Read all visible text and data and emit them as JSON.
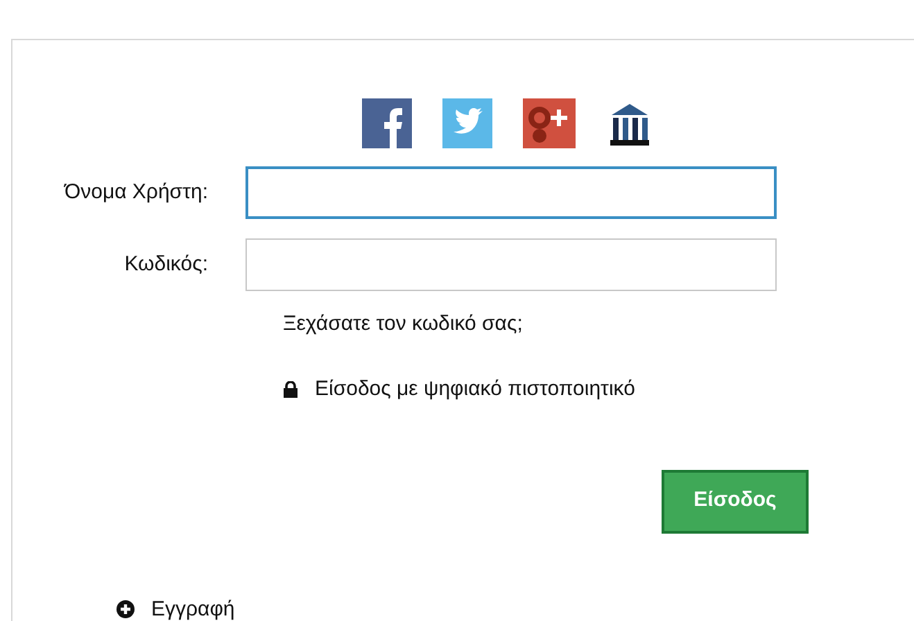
{
  "social_logins": [
    {
      "kind": "facebook"
    },
    {
      "kind": "twitter"
    },
    {
      "kind": "googleplus"
    },
    {
      "kind": "institution"
    }
  ],
  "fields": [
    {
      "label": "Όνομα Χρήστη:",
      "focused": true
    },
    {
      "label": "Κωδικός:",
      "focused": false
    }
  ],
  "forgot_link": "Ξεχάσατε τον κωδικό σας;",
  "certificate_link": "Είσοδος με ψηφιακό πιστοποιητικό",
  "submit_button": "Είσοδος",
  "register_link": "Εγγραφή"
}
